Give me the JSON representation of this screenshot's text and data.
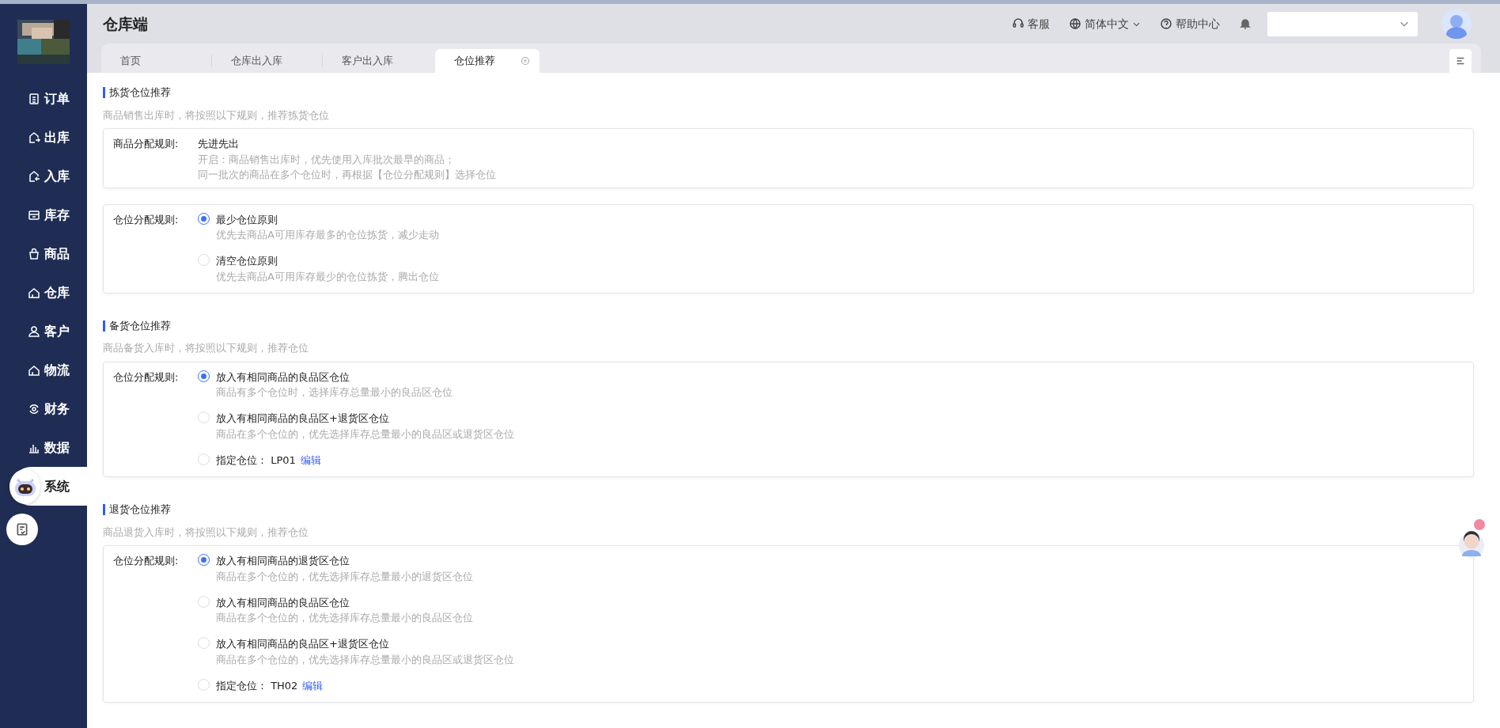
{
  "header": {
    "title": "仓库端",
    "links": [
      {
        "label": "客服",
        "kind": "support"
      },
      {
        "label": "简体中文",
        "kind": "language",
        "dropdown": true
      },
      {
        "label": "帮助中心",
        "kind": "help"
      }
    ]
  },
  "tabs": [
    {
      "label": "首页",
      "selected": false,
      "closable": false
    },
    {
      "label": "仓库出入库",
      "selected": false,
      "closable": false
    },
    {
      "label": "客户出入库",
      "selected": false,
      "closable": false
    },
    {
      "label": "仓位推荐",
      "selected": true,
      "closable": true
    }
  ],
  "sidebar": {
    "items": [
      {
        "label": "订单",
        "selected": false
      },
      {
        "label": "出库",
        "selected": false
      },
      {
        "label": "入库",
        "selected": false
      },
      {
        "label": "库存",
        "selected": false
      },
      {
        "label": "商品",
        "selected": false
      },
      {
        "label": "仓库",
        "selected": false
      },
      {
        "label": "客户",
        "selected": false
      },
      {
        "label": "物流",
        "selected": false
      },
      {
        "label": "财务",
        "selected": false
      },
      {
        "label": "数据",
        "selected": false
      },
      {
        "label": "系统",
        "selected": true
      }
    ]
  },
  "sections": [
    {
      "title": "拣货仓位推荐",
      "description": "商品销售出库时，将按照以下规则，推荐拣货仓位",
      "cards": [
        {
          "kind": "text",
          "label": "商品分配规则:",
          "value": "先进先出",
          "lines": [
            "开启：商品销售出库时，优先使用入库批次最早的商品；",
            "同一批次的商品在多个仓位时，再根据【仓位分配规则】选择仓位"
          ]
        },
        {
          "kind": "radio",
          "label": "仓位分配规则:",
          "options": [
            {
              "title": "最少仓位原则",
              "description": "优先去商品A可用库存最多的仓位拣货，减少走动",
              "selected": true
            },
            {
              "title": "清空仓位原则",
              "description": "优先去商品A可用库存最少的仓位拣货，腾出仓位",
              "selected": false
            }
          ]
        }
      ]
    },
    {
      "title": "备货仓位推荐",
      "description": "商品备货入库时，将按照以下规则，推荐仓位",
      "cards": [
        {
          "kind": "radio",
          "label": "仓位分配规则:",
          "options": [
            {
              "title": "放入有相同商品的良品区仓位",
              "description": "商品有多个仓位时，选择库存总量最小的良品区仓位",
              "selected": true
            },
            {
              "title": "放入有相同商品的良品区+退货区仓位",
              "description": "商品在多个仓位的，优先选择库存总量最小的良品区或退货区仓位",
              "selected": false
            },
            {
              "title": "指定仓位：",
              "value": "LP01",
              "link": "编辑",
              "selected": false
            }
          ]
        }
      ]
    },
    {
      "title": "退货仓位推荐",
      "description": "商品退货入库时，将按照以下规则，推荐仓位",
      "cards": [
        {
          "kind": "radio",
          "label": "仓位分配规则:",
          "options": [
            {
              "title": "放入有相同商品的退货区仓位",
              "description": "商品在多个仓位的，优先选择库存总量最小的退货区仓位",
              "selected": true
            },
            {
              "title": "放入有相同商品的良品区仓位",
              "description": "商品在多个仓位的，优先选择库存总量最小的良品区仓位",
              "selected": false
            },
            {
              "title": "放入有相同商品的良品区+退货区仓位",
              "description": "商品在多个仓位的，优先选择库存总量最小的良品区或退货区仓位",
              "selected": false
            },
            {
              "title": "指定仓位：",
              "value": "TH02",
              "link": "编辑",
              "selected": false
            }
          ]
        }
      ]
    }
  ]
}
